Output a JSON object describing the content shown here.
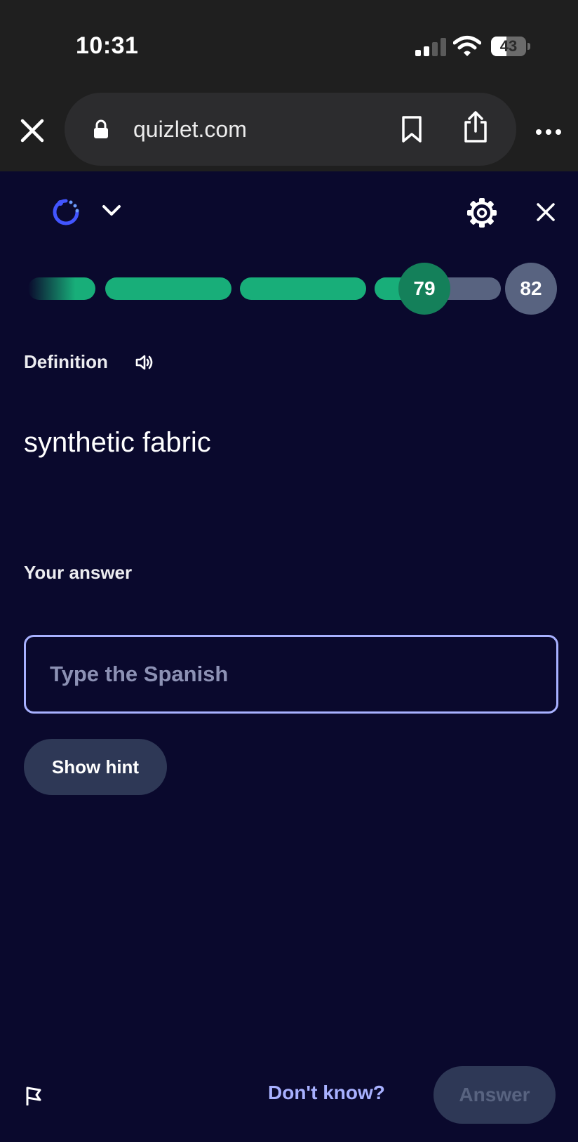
{
  "status_bar": {
    "time": "10:31",
    "battery_label": "43",
    "battery_level": 0.43,
    "signal_bars": 2
  },
  "browser": {
    "url": "quizlet.com",
    "icons": [
      "close-icon",
      "lock-icon",
      "bookmark-icon",
      "share-icon",
      "more-icon"
    ]
  },
  "header": {
    "icons": [
      "learn-mode-icon",
      "chevron-down-icon",
      "settings-gear-icon",
      "close-icon"
    ]
  },
  "progress": {
    "current": "79",
    "total": "82",
    "last_segment_fill": 0.45
  },
  "question": {
    "label": "Definition",
    "text": "synthetic fabric"
  },
  "answer": {
    "label": "Your answer",
    "placeholder": "Type the Spanish",
    "value": ""
  },
  "hint_button": {
    "label": "Show hint"
  },
  "footer": {
    "dont_know": "Don't know?",
    "answer_button": "Answer"
  },
  "colors": {
    "background": "#0a092d",
    "progress_green": "#18ae79",
    "current_badge": "#14805a",
    "neutral_gray": "#586380",
    "input_border": "#a8b1ff",
    "button_bg": "#2e3856"
  }
}
